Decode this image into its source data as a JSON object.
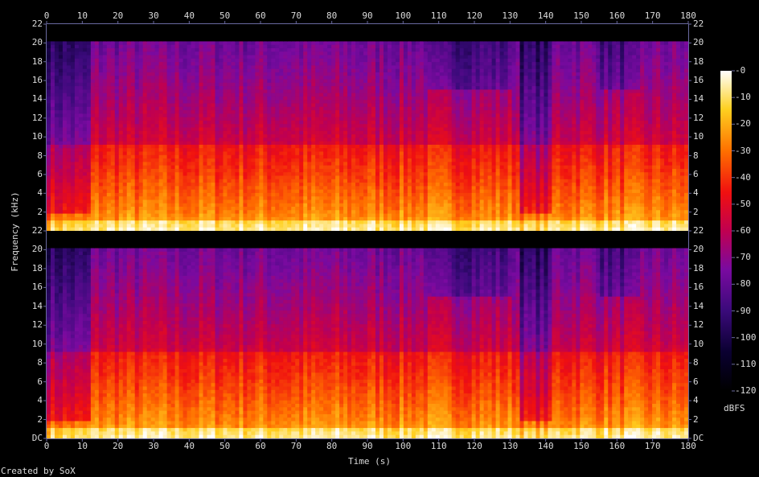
{
  "chart_data": {
    "type": "heatmap",
    "subtype": "spectrogram",
    "title": "",
    "xlabel": "Time (s)",
    "ylabel": "Frequency (kHz)",
    "xlim": [
      0,
      180
    ],
    "ylim": [
      0,
      22
    ],
    "x_ticks": [
      "0",
      "10",
      "20",
      "30",
      "40",
      "50",
      "60",
      "70",
      "80",
      "90",
      "100",
      "110",
      "120",
      "130",
      "140",
      "150",
      "160",
      "170",
      "180"
    ],
    "y_ticks_upper": [
      "22",
      "20",
      "18",
      "16",
      "14",
      "12",
      "10",
      "8",
      "6",
      "4",
      "2"
    ],
    "y_ticks_lower": [
      "22",
      "20",
      "18",
      "16",
      "14",
      "12",
      "10",
      "8",
      "6",
      "4",
      "2",
      "DC"
    ],
    "colorbar": {
      "label": "dBFS",
      "range": [
        -120,
        0
      ],
      "ticks": [
        "-0",
        "-10",
        "-20",
        "-30",
        "-40",
        "-50",
        "-60",
        "-70",
        "-80",
        "-90",
        "-100",
        "-110",
        "-120"
      ]
    },
    "channels": [
      {
        "name": "",
        "lowpass_cutoff_khz": 20
      },
      {
        "name": "",
        "lowpass_cutoff_khz": 20
      }
    ],
    "quiet_segments_s": [
      [
        0,
        12
      ],
      [
        133,
        142
      ]
    ],
    "reduced_high_band_segments_s": [
      [
        107,
        130
      ],
      [
        155,
        167
      ]
    ],
    "colors": {
      "background": "#000000",
      "text": "#dcdcdc",
      "axis": "#6a6aa0"
    }
  },
  "footer": {
    "credit": "Created by SoX"
  }
}
